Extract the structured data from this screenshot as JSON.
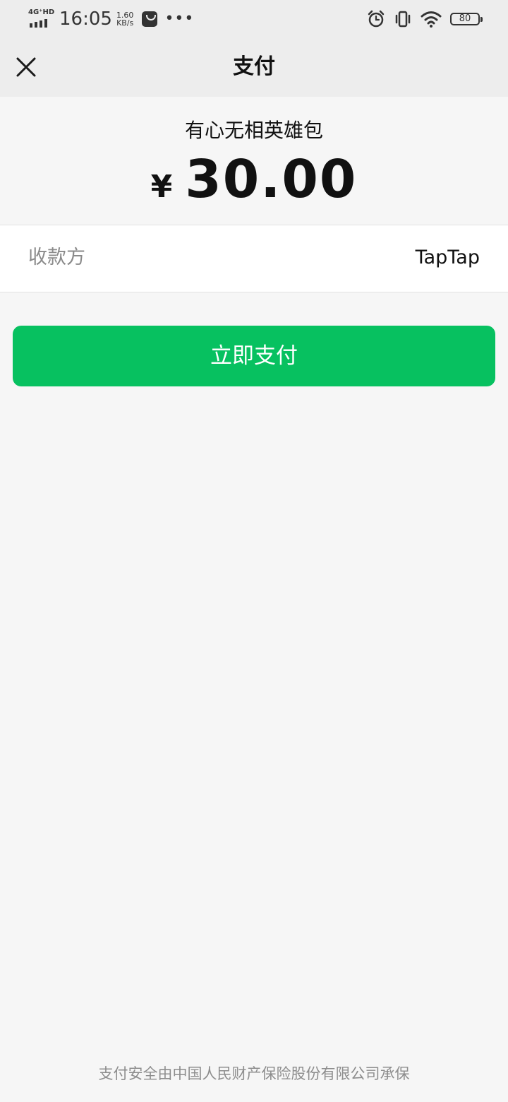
{
  "status_bar": {
    "network": "4G⁺HD",
    "time": "16:05",
    "speed_value": "1.60",
    "speed_unit": "KB/s",
    "more": "•••",
    "battery": "80"
  },
  "nav": {
    "title": "支付",
    "close_icon": "close-icon"
  },
  "order": {
    "product_name": "有心无相英雄包",
    "currency_symbol": "¥",
    "amount": "30.00"
  },
  "payee": {
    "label": "收款方",
    "value": "TapTap"
  },
  "actions": {
    "pay_label": "立即支付",
    "pay_color": "#07c160"
  },
  "footer": {
    "insurance_note": "支付安全由中国人民财产保险股份有限公司承保"
  }
}
